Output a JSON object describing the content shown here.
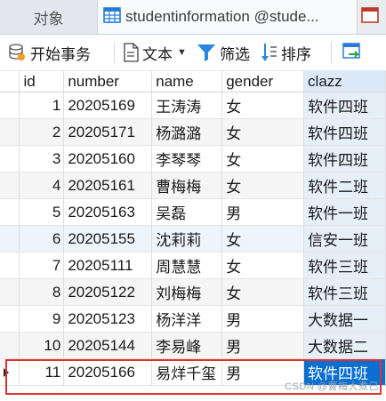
{
  "tabs": {
    "objects_label": "对象",
    "table_tab_label": "studentinformation @stude..."
  },
  "toolbar": {
    "begin_transaction": "开始事务",
    "text": "文本",
    "filter": "筛选",
    "sort": "排序"
  },
  "grid": {
    "columns": [
      "id",
      "number",
      "name",
      "gender",
      "clazz"
    ],
    "rows": [
      [
        "1",
        "20205169",
        "王涛涛",
        "女",
        "软件四班"
      ],
      [
        "2",
        "20205171",
        "杨潞潞",
        "女",
        "软件四班"
      ],
      [
        "3",
        "20205160",
        "李琴琴",
        "女",
        "软件四班"
      ],
      [
        "4",
        "20205161",
        "曹梅梅",
        "女",
        "软件二班"
      ],
      [
        "5",
        "20205163",
        "吴磊",
        "男",
        "软件一班"
      ],
      [
        "6",
        "20205155",
        "沈莉莉",
        "女",
        "信安一班"
      ],
      [
        "7",
        "20205111",
        "周慧慧",
        "女",
        "软件三班"
      ],
      [
        "8",
        "20205122",
        "刘梅梅",
        "女",
        "软件三班"
      ],
      [
        "9",
        "20205123",
        "杨洋洋",
        "男",
        "大数据一"
      ],
      [
        "10",
        "20205144",
        "李易峰",
        "男",
        "大数据二"
      ],
      [
        "11",
        "20205166",
        "易烊千玺",
        "男",
        "软件四班"
      ]
    ]
  },
  "watermark": "CSDN @曹梅大煮已",
  "colors": {
    "selection": "#0a6fd1",
    "highlight_border": "#e03030",
    "tab_bar": "#e9edf2"
  }
}
